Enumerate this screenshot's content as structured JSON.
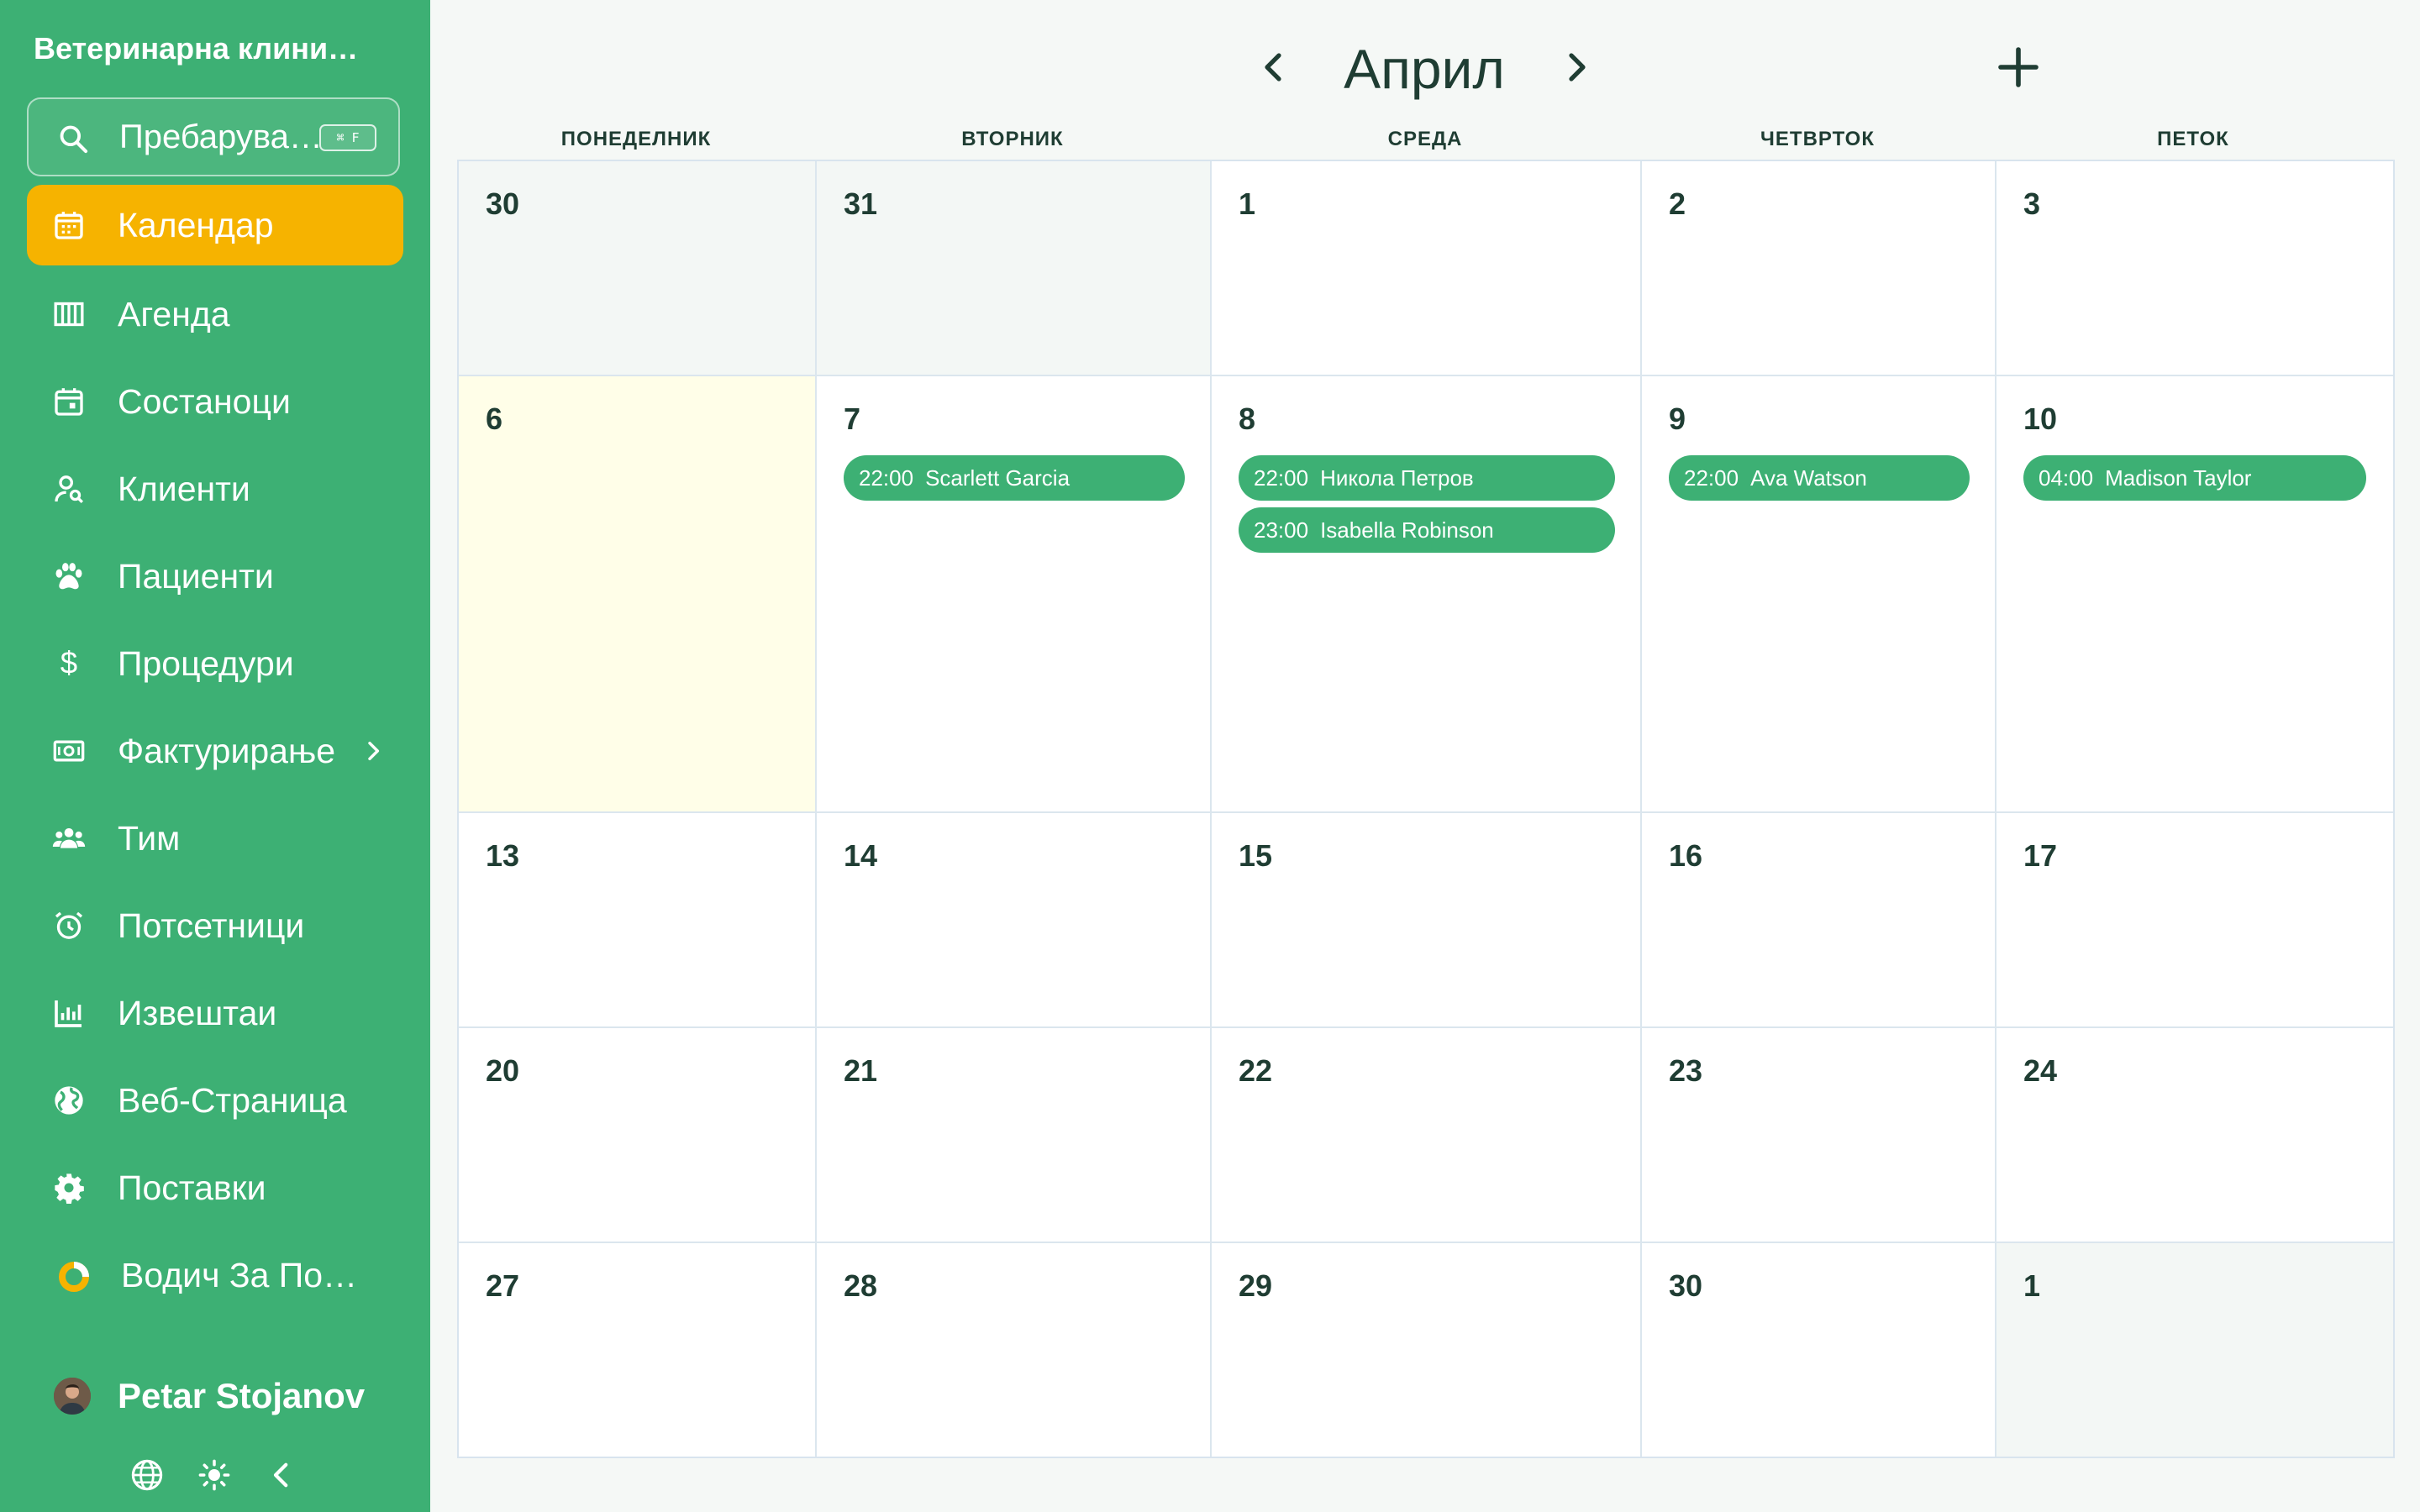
{
  "app": {
    "clinic_name": "Ветеринарна клини…"
  },
  "search": {
    "placeholder": "Пребарува…",
    "shortcut": "⌘ F"
  },
  "sidebar": {
    "items": [
      {
        "label": "Календар",
        "icon": "calendar-icon",
        "active": true
      },
      {
        "label": "Агенда",
        "icon": "agenda-icon"
      },
      {
        "label": "Состаноци",
        "icon": "meeting-icon"
      },
      {
        "label": "Клиенти",
        "icon": "clients-icon"
      },
      {
        "label": "Пациенти",
        "icon": "paw-icon"
      },
      {
        "label": "Процедури",
        "icon": "dollar-icon"
      },
      {
        "label": "Фактурирање",
        "icon": "billing-icon",
        "has_submenu": true
      },
      {
        "label": "Тим",
        "icon": "team-icon"
      },
      {
        "label": "Потсетници",
        "icon": "alarm-icon"
      },
      {
        "label": "Извештаи",
        "icon": "reports-icon"
      },
      {
        "label": "Веб-Страница",
        "icon": "globe-icon"
      },
      {
        "label": "Поставки",
        "icon": "gear-icon"
      }
    ],
    "guide_label": "Водич За Пост…",
    "guide_progress": 0.25,
    "user_name": "Petar Stojanov"
  },
  "calendar": {
    "month": "Април",
    "weekdays": [
      "ПОНЕДЕЛНИК",
      "ВТОРНИК",
      "СРЕДА",
      "ЧЕТВРТОК",
      "ПЕТОК"
    ],
    "weeks": [
      [
        {
          "d": "30",
          "muted": true
        },
        {
          "d": "31",
          "muted": true
        },
        {
          "d": "1"
        },
        {
          "d": "2"
        },
        {
          "d": "3"
        }
      ],
      [
        {
          "d": "6",
          "today": true
        },
        {
          "d": "7",
          "events": [
            {
              "time": "22:00",
              "name": "Scarlett Garcia"
            }
          ]
        },
        {
          "d": "8",
          "events": [
            {
              "time": "22:00",
              "name": "Никола Петров"
            },
            {
              "time": "23:00",
              "name": "Isabella Robinson"
            }
          ]
        },
        {
          "d": "9",
          "events": [
            {
              "time": "22:00",
              "name": "Ava Watson"
            }
          ]
        },
        {
          "d": "10",
          "events": [
            {
              "time": "04:00",
              "name": "Madison Taylor"
            }
          ]
        }
      ],
      [
        {
          "d": "13"
        },
        {
          "d": "14"
        },
        {
          "d": "15"
        },
        {
          "d": "16"
        },
        {
          "d": "17"
        }
      ],
      [
        {
          "d": "20"
        },
        {
          "d": "21"
        },
        {
          "d": "22"
        },
        {
          "d": "23"
        },
        {
          "d": "24"
        }
      ],
      [
        {
          "d": "27"
        },
        {
          "d": "28"
        },
        {
          "d": "29"
        },
        {
          "d": "30"
        },
        {
          "d": "1",
          "muted": true
        }
      ]
    ]
  },
  "colors": {
    "sidebar": "#3db074",
    "active": "#f6b300",
    "event": "#3db074",
    "today": "#fffee8"
  }
}
